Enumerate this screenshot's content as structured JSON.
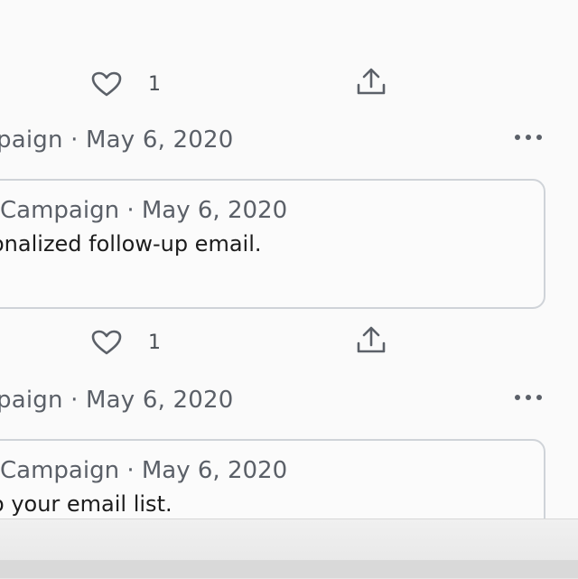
{
  "posts": [
    {
      "actions": {
        "like_count": "1"
      }
    },
    {
      "header": "paign · May 6, 2020",
      "quote": {
        "meta": "Campaign · May 6, 2020",
        "text": "onalized follow-up email."
      },
      "actions": {
        "like_count": "1"
      }
    },
    {
      "header": "paign · May 6, 2020",
      "quote": {
        "meta": "Campaign · May 6, 2020",
        "text": "o your email list."
      }
    }
  ],
  "icons": {
    "like": "heart-outline-icon",
    "share": "share-upload-icon",
    "more": "more-horizontal-icon"
  },
  "colors": {
    "meta_text": "#5b6068",
    "body_text": "#1c1c1c",
    "card_border": "#cfd3d8",
    "icon": "#5b6068"
  }
}
